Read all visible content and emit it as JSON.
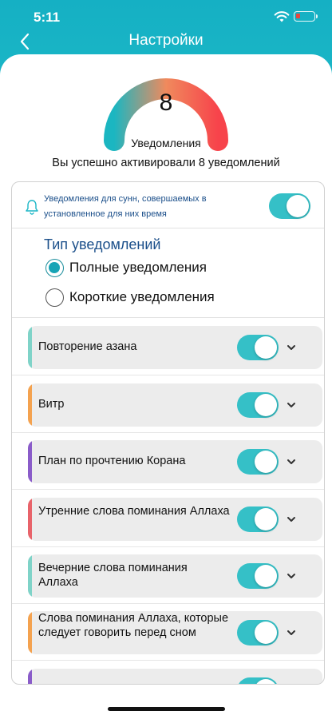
{
  "status_bar": {
    "time": "5:11"
  },
  "nav": {
    "title": "Настройки",
    "back_icon": "chevron-left-icon"
  },
  "gauge": {
    "value": "8",
    "label": "Уведомления",
    "gradient": [
      "#1bb6c1",
      "#f08a5d",
      "#f7434b"
    ]
  },
  "summary": {
    "text": "Вы успешно активировали 8 уведомлений"
  },
  "sunnah": {
    "text": "Уведомления для сунн, совершаемых в установленное для них время",
    "icon": "bell-icon",
    "enabled": true
  },
  "notification_type": {
    "title": "Тип уведомлений",
    "options": [
      {
        "label": "Полные уведомления",
        "selected": true
      },
      {
        "label": "Короткие уведомления",
        "selected": false
      }
    ]
  },
  "colors": {
    "accent": "#1ab6c6",
    "toggle_on": "#35c0c7",
    "heading": "#1b4f8a"
  },
  "items": [
    {
      "label": "Повторение азана",
      "accent": "#7fd3c8",
      "enabled": true
    },
    {
      "label": "Витр",
      "accent": "#f4a24f",
      "enabled": true
    },
    {
      "label": "План по прочтению Корана",
      "accent": "#8a5cc9",
      "enabled": true
    },
    {
      "label": "Утренние слова поминания Аллаха",
      "accent": "#e8636a",
      "enabled": true
    },
    {
      "label": "Вечерние слова поминания Аллаха",
      "accent": "#7fd3c8",
      "enabled": true
    },
    {
      "label": "Слова поминания Аллаха, которые следует говорить перед сном",
      "accent": "#f4a24f",
      "enabled": true
    },
    {
      "label": "",
      "accent": "#8a5cc9",
      "enabled": true
    }
  ]
}
